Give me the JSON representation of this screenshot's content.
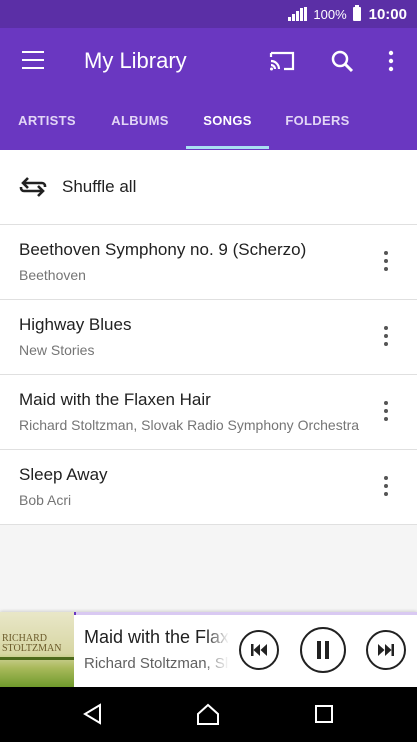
{
  "status_bar": {
    "battery": "100%",
    "time": "10:00"
  },
  "app_bar": {
    "title": "My Library",
    "icons": [
      "menu-icon",
      "cast-icon",
      "search-icon",
      "more-vert-icon"
    ]
  },
  "tabs": [
    {
      "label": "ARTISTS",
      "active": false
    },
    {
      "label": "ALBUMS",
      "active": false
    },
    {
      "label": "SONGS",
      "active": true
    },
    {
      "label": "FOLDERS",
      "active": false
    }
  ],
  "shuffle": {
    "label": "Shuffle all",
    "icon": "shuffle-icon"
  },
  "songs": [
    {
      "title": "Beethoven Symphony no. 9 (Scherzo)",
      "artist": "Beethoven"
    },
    {
      "title": "Highway Blues",
      "artist": "New Stories"
    },
    {
      "title": "Maid with the Flaxen Hair",
      "artist": "Richard Stoltzman, Slovak Radio Symphony Orchestra"
    },
    {
      "title": "Sleep Away",
      "artist": "Bob Acri"
    }
  ],
  "now_playing": {
    "title": "Maid with the Flaxen Hair",
    "artist": "Richard Stoltzman, Slovak Radio Symphony Orchestra",
    "art_text": "RICHARD STOLTZMAN",
    "progress": 0.003,
    "controls": [
      "previous-icon",
      "pause-icon",
      "next-icon"
    ]
  },
  "nav_bar": {
    "icons": [
      "back-icon",
      "home-icon",
      "recents-icon"
    ]
  },
  "colors": {
    "primary": "#6a37c1",
    "status_bar": "#5b2fa6",
    "tab_indicator": "#a9dff2"
  }
}
